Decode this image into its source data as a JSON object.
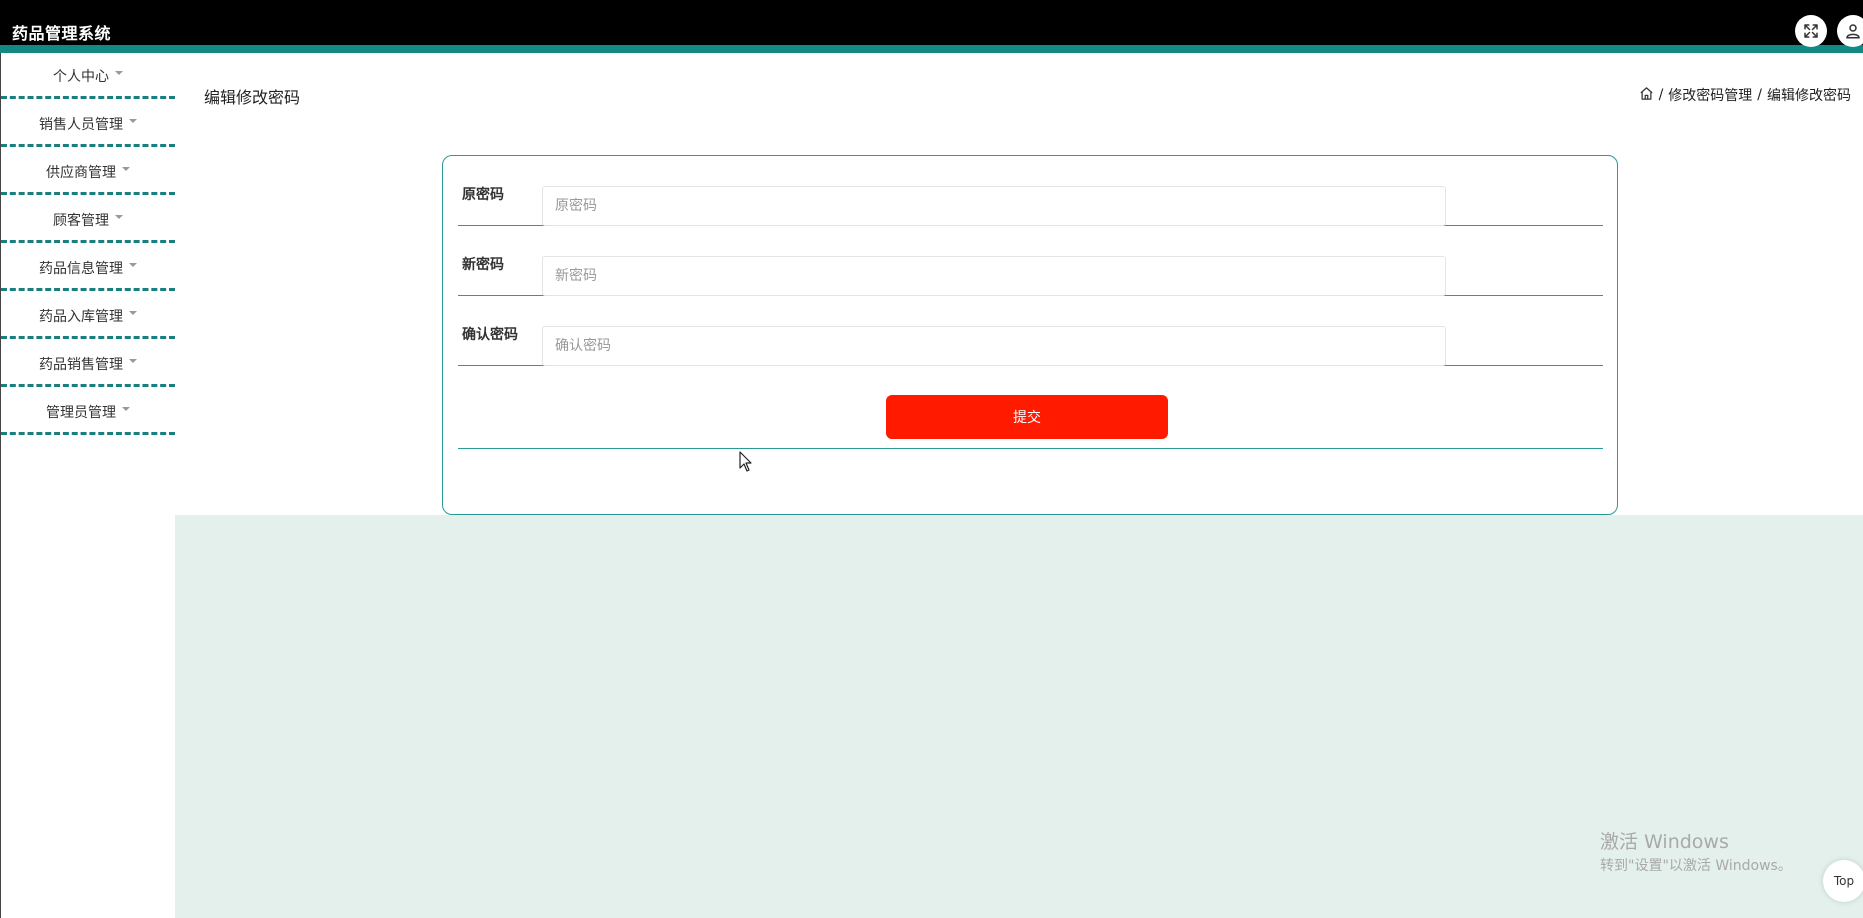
{
  "header": {
    "app_title": "药品管理系统",
    "fullscreen_icon": "fullscreen-icon",
    "user_icon": "user-icon"
  },
  "sidebar": {
    "items": [
      {
        "label": "个人中心"
      },
      {
        "label": "销售人员管理"
      },
      {
        "label": "供应商管理"
      },
      {
        "label": "顾客管理"
      },
      {
        "label": "药品信息管理"
      },
      {
        "label": "药品入库管理"
      },
      {
        "label": "药品销售管理"
      },
      {
        "label": "管理员管理"
      }
    ]
  },
  "main": {
    "page_title": "编辑修改密码",
    "breadcrumb": {
      "home_icon": "home-icon",
      "separator": "/",
      "items": [
        "修改密码管理",
        "编辑修改密码"
      ]
    },
    "form": {
      "fields": [
        {
          "label": "原密码",
          "placeholder": "原密码",
          "value": ""
        },
        {
          "label": "新密码",
          "placeholder": "新密码",
          "value": ""
        },
        {
          "label": "确认密码",
          "placeholder": "确认密码",
          "value": ""
        }
      ],
      "submit_label": "提交"
    }
  },
  "overlay": {
    "watermark_title": "激活 Windows",
    "watermark_sub": "转到\"设置\"以激活 Windows。",
    "top_button_label": "Top"
  },
  "colors": {
    "accent": "#128a84",
    "submit": "#ff1a00",
    "content_bg": "#e3f0ec"
  }
}
